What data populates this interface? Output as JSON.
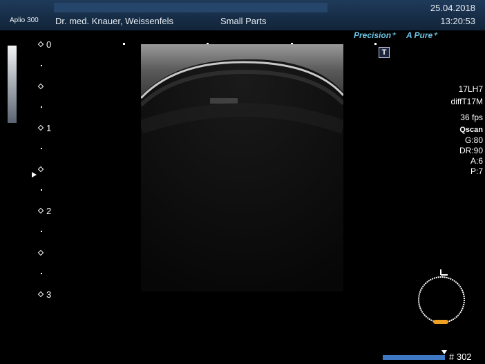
{
  "header": {
    "model": "Aplio 300",
    "institution": "Dr. med. Knauer, Weissenfels",
    "preset": "Small Parts",
    "date": "25.04.2018",
    "time": "13:20:53"
  },
  "modes": {
    "precision": "Precision⁺",
    "apure": "A Pure⁺",
    "t_badge": "T"
  },
  "depth_scale": {
    "labels": [
      "0",
      "1",
      "2",
      "3"
    ]
  },
  "params": {
    "probe": "17LH7",
    "mode": "diffT17M",
    "fps": "36 fps",
    "qscan": "Qscan",
    "gain": "G:80",
    "dr": "DR:90",
    "a": "A:6",
    "p": "P:7"
  },
  "frame": {
    "label": "# 302"
  },
  "colors": {
    "header": "#1f3a5a",
    "accent_cyan": "#6cc6e6",
    "probe_marker": "#f0a020",
    "frame_bar": "#3e78c4"
  }
}
